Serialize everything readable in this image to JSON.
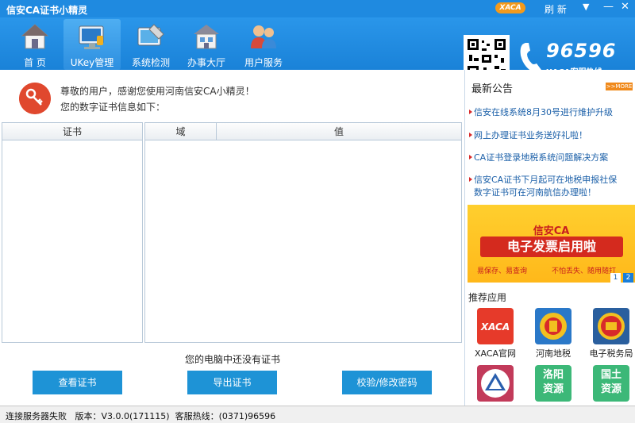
{
  "window": {
    "title": "信安CA证书小精灵",
    "badge": "XACA",
    "refresh": "刷 新",
    "menu": "▼",
    "minimize": "—",
    "close": "✕"
  },
  "nav": [
    {
      "label": "首 页",
      "icon": "house-icon"
    },
    {
      "label": "UKey管理",
      "icon": "ukey-monitor-icon"
    },
    {
      "label": "系统检测",
      "icon": "system-check-icon"
    },
    {
      "label": "办事大厅",
      "icon": "hall-icon"
    },
    {
      "label": "用户服务",
      "icon": "users-icon"
    }
  ],
  "active_nav": 1,
  "hotline": {
    "number": "96596",
    "sub": "XACA客服热线"
  },
  "main": {
    "greeting_line1": "尊敬的用户，感谢您使用河南信安CA小精灵！",
    "greeting_line2": "您的数字证书信息如下：",
    "cert_col": "证书",
    "field_col": "域",
    "value_col": "值",
    "empty_msg": "您的电脑中还没有证书",
    "buttons": [
      "查看证书",
      "导出证书",
      "校验/修改密码"
    ]
  },
  "notices": {
    "title": "最新公告",
    "more": ">>MORE",
    "items": [
      "信安在线系统8月30号进行维护升级",
      "网上办理证书业务送好礼啦！",
      "CA证书登录地税系统问题解决方案",
      "信安CA证书下月起可在地税申报社保",
      "数字证书可在河南航信办理啦！"
    ]
  },
  "banner": {
    "brand": "信安CA",
    "headline": "电子发票启用啦",
    "feature1": "易保存、易查询",
    "feature2": "不怕丢失、随用随打",
    "pages": [
      "1",
      "2"
    ]
  },
  "recommend": {
    "title": "推荐应用",
    "apps": [
      {
        "label": "XACA官网",
        "icon": "xaca-logo-icon",
        "color": "#e63a2a"
      },
      {
        "label": "河南地税",
        "icon": "tax-emblem-icon",
        "color": "#2a78c8"
      },
      {
        "label": "电子税务局",
        "icon": "national-emblem-icon",
        "color": "#2a5f9e"
      },
      {
        "label": "",
        "icon": "shield-app-icon",
        "color": "#c23a5a"
      },
      {
        "label": "洛阳资源",
        "icon": "",
        "color": "#3cb878"
      },
      {
        "label": "国土资源",
        "icon": "",
        "color": "#3cb878"
      }
    ],
    "tile_text": [
      "",
      "",
      "",
      "",
      "洛阳\n资源",
      "国土\n资源"
    ]
  },
  "status": {
    "text": "连接服务器失败   版本：V3.0.0(171115)  客服热线：(0371)96596"
  }
}
